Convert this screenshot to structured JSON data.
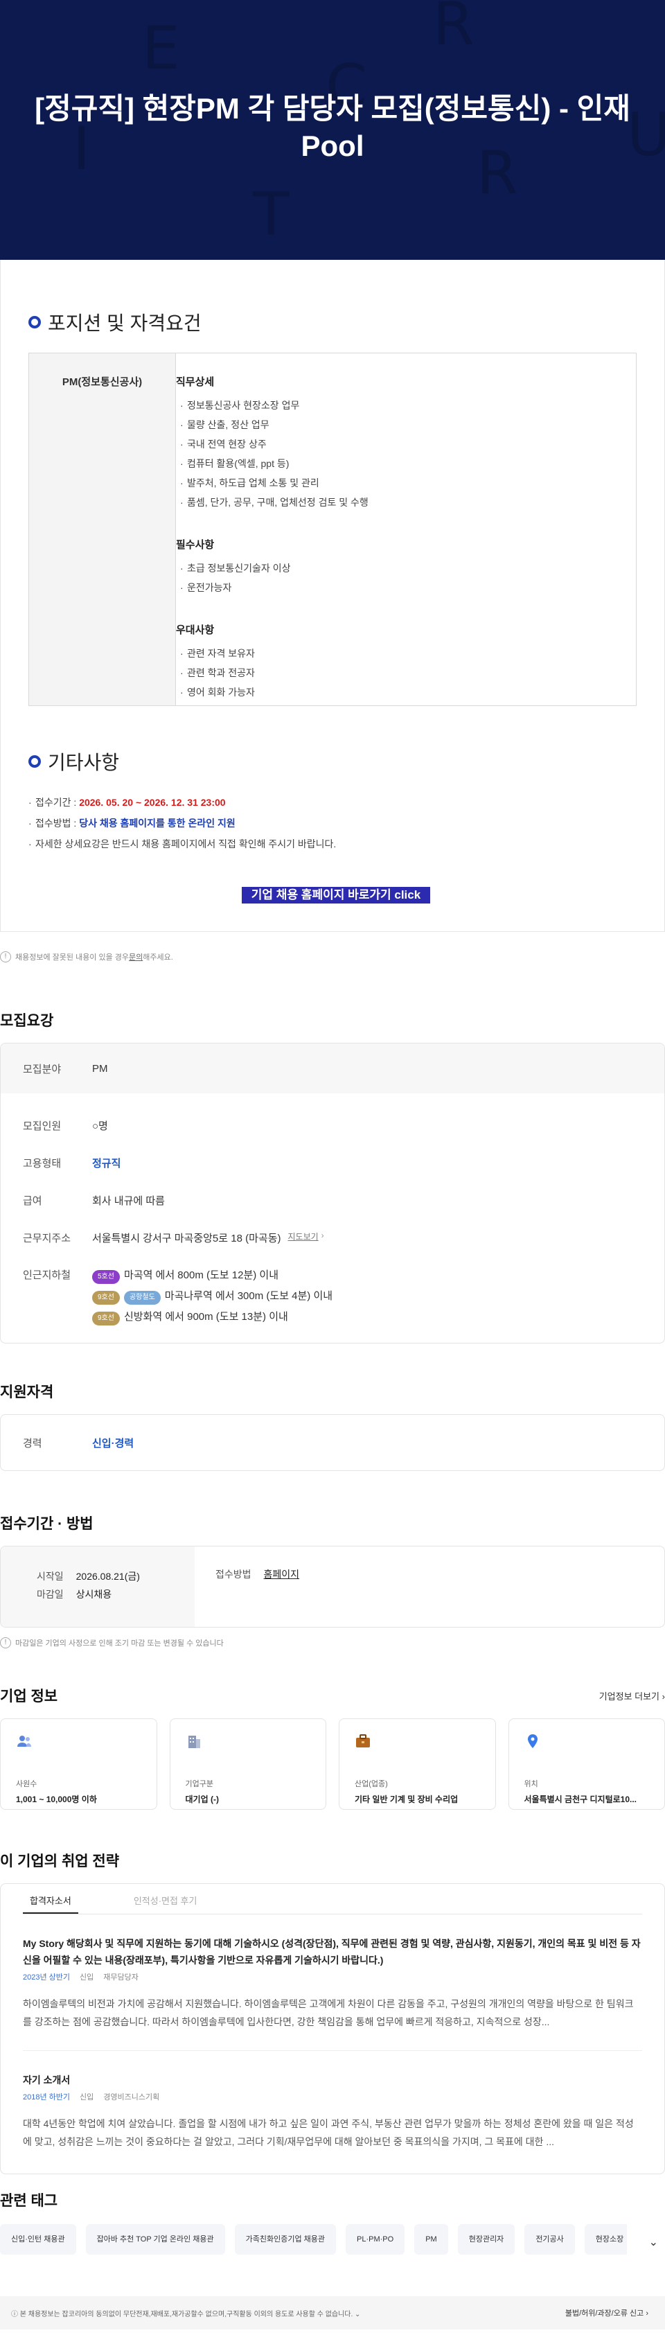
{
  "hero": {
    "title": "[정규직] 현장PM 각 담당자 모집(정보통신) - 인재 Pool",
    "deco_letters": [
      "E",
      "C",
      "I",
      "T",
      "R",
      "R",
      "U",
      "R"
    ]
  },
  "position": {
    "section_title": "포지션 및 자격요건",
    "role": "PM(정보통신공사)",
    "groups": [
      {
        "title": "직무상세",
        "items": [
          "정보통신공사 현장소장 업무",
          "물량 산출, 정산 업무",
          "국내 전역 현장 상주",
          "컴퓨터 활용(엑셀, ppt 등)",
          "발주처, 하도급 업체 소통 및 관리",
          "품셈, 단가, 공무, 구매, 업체선정 검토 및 수행"
        ]
      },
      {
        "title": "필수사항",
        "items": [
          "초급 정보통신기술자 이상",
          "운전가능자"
        ]
      },
      {
        "title": "우대사항",
        "items": [
          "관련 자격 보유자",
          "관련 학과 전공자",
          "영어 회화 가능자"
        ]
      }
    ]
  },
  "etc": {
    "section_title": "기타사항",
    "period_label": "접수기간 : ",
    "period_value": "2026. 05. 20 ~ 2026. 12. 31  23:00",
    "method_label": "접수방법 : ",
    "method_value": "당사 채용 홈페이지를 통한 온라인 지원",
    "detail": "자세한 상세요강은 반드시 채용 홈페이지에서 직접 확인해 주시기 바랍니다.",
    "cta": "기업 채용 홈페이지 바로가기 click"
  },
  "notice1": {
    "text": "채용정보에 잘못된 내용이 있을 경우 ",
    "link": "문의",
    "text2": "해주세요."
  },
  "recruit": {
    "title": "모집요강",
    "field_label": "모집분야",
    "field_value": "PM",
    "headcount_label": "모집인원",
    "headcount_value": "○명",
    "type_label": "고용형태",
    "type_value": "정규직",
    "salary_label": "급여",
    "salary_value": "회사 내규에 따름",
    "address_label": "근무지주소",
    "address_value": "서울특별시 강서구 마곡중앙5로 18 (마곡동)",
    "map_link": "지도보기",
    "subway_label": "인근지하철",
    "subways": [
      {
        "badges": [
          {
            "text": "5호선",
            "color": "#8b3fc8"
          }
        ],
        "text": "마곡역 에서 800m (도보 12분) 이내"
      },
      {
        "badges": [
          {
            "text": "9호선",
            "color": "#b99b58"
          },
          {
            "text": "공항철도",
            "color": "#78a8d8"
          }
        ],
        "text": "마곡나루역 에서 300m (도보 4분) 이내"
      },
      {
        "badges": [
          {
            "text": "9호선",
            "color": "#b99b58"
          }
        ],
        "text": "신방화역 에서 900m (도보 13분) 이내"
      }
    ]
  },
  "qualification": {
    "title": "지원자격",
    "career_label": "경력",
    "career_value": "신입·경력"
  },
  "apply": {
    "title": "접수기간 · 방법",
    "start_label": "시작일",
    "start_value": "2026.08.21(금)",
    "end_label": "마감일",
    "end_value": "상시채용",
    "method_label": "접수방법",
    "method_value": "홈페이지",
    "note": "마감일은 기업의 사정으로 인해 조기 마감 또는 변경될 수 있습니다"
  },
  "company": {
    "title": "기업 정보",
    "more": "기업정보 더보기",
    "cards": [
      {
        "icon": "people-icon",
        "label": "사원수",
        "value": "1,001 ~ 10,000명 이하"
      },
      {
        "icon": "building-icon",
        "label": "기업구분",
        "value": "대기업 (-)"
      },
      {
        "icon": "briefcase-icon",
        "label": "산업(업종)",
        "value": "기타 일반 기계 및 장비 수리업"
      },
      {
        "icon": "location-pin-icon",
        "label": "위치",
        "value": "서울특별시 금천구 디지털로10..."
      }
    ]
  },
  "strategy": {
    "title": "이 기업의 취업 전략",
    "tabs": [
      "합격자소서",
      "인적성·면접 후기"
    ],
    "items": [
      {
        "title": "My Story 해당회사 및 직무에 지원하는 동기에 대해 기술하시오 (성격(장단점), 직무에 관련된 경험 및 역량, 관심사항, 지원동기, 개인의 목표 및 비전 등 자신을 어필할 수 있는 내용(장래포부), 특기사항을 기반으로 자유롭게 기술하시기 바랍니다.)",
        "year": "2023년 상반기",
        "level": "신입",
        "job": "재무담당자",
        "body": "하이엠솔루텍의 비전과 가치에 공감해서 지원했습니다. 하이엠솔루텍은 고객에게 차원이 다른 감동을 주고, 구성원의 개개인의 역량을 바탕으로 한 팀워크를 강조하는 점에 공감했습니다. 따라서 하이엠솔루텍에 입사한다면, 강한 책임감을 통해 업무에 빠르게 적응하고, 지속적으로 성장..."
      },
      {
        "title": "자기 소개서",
        "year": "2018년 하반기",
        "level": "신입",
        "job": "경영비즈니스기획",
        "body": "대학 4년동안 학업에 치여 살았습니다. 졸업을 할 시점에 내가 하고 싶은 일이 과연 주식, 부동산 관련 업무가 맞을까 하는 정체성 혼란에 왔을 때 일은 적성에 맞고, 성취감은 느끼는 것이 중요하다는 걸 알았고, 그러다 기획/재무업무에 대해 알아보던 중 목표의식을 가지며, 그 목표에 대한 ..."
      }
    ]
  },
  "tags": {
    "title": "관련 태그",
    "items": [
      "신입·인턴 채용관",
      "잡아바 추천 TOP 기업 온라인 채용관",
      "가족친화인증기업 채용관",
      "PL·PM·PO",
      "PM",
      "현장관리자",
      "전기공사",
      "현장소장"
    ]
  },
  "footer": {
    "text": "본 채용정보는 잡코리아의 동의없이 무단전재,재배포,재가공할수 없으며,구직활동 이외의 용도로 사용할 수 없습니다.",
    "report": "불법/허위/과장/오류 신고"
  }
}
